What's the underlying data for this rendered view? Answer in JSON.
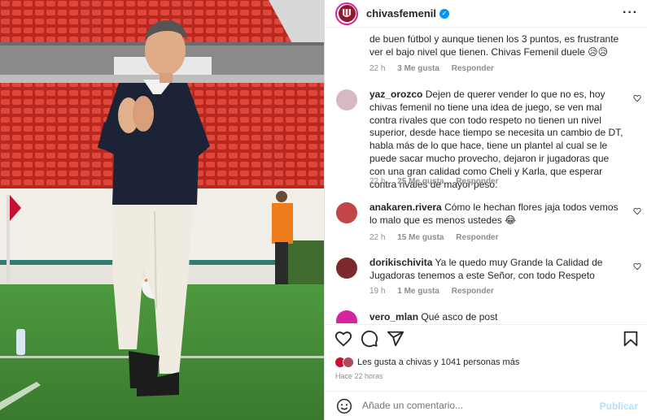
{
  "post": {
    "username": "chivasfemenil",
    "verified_mark": "✓",
    "more_icon": "more-horizontal-icon"
  },
  "comments": [
    {
      "username": "",
      "text": "de buen fútbol y aunque tienen los 3 puntos, es frustrante ver el bajo nivel que tienen. Chivas Femenil duele 😥😥",
      "time": "22 h",
      "likes": "3 Me gusta",
      "reply": "Responder"
    },
    {
      "username": "yaz_orozco",
      "text": "Dejen de querer vender lo que no es, hoy chivas femenil no tiene una idea de juego, se ven mal contra rivales que con todo respeto no tienen un nivel superior, desde hace tiempo se necesita un cambio de DT, habla más de lo que hace, tiene un plantel al cual se le puede sacar mucho provecho, dejaron ir jugadoras que con una gran calidad como Cheli y Karla, que esperar contra rivales de mayor peso.",
      "time": "22 h",
      "likes": "25 Me gusta",
      "reply": "Responder"
    },
    {
      "username": "anakaren.rivera",
      "text": "Cómo le hechan flores jaja todos vemos lo malo que es menos ustedes 😂",
      "time": "22 h",
      "likes": "15 Me gusta",
      "reply": "Responder"
    },
    {
      "username": "dorikischivita",
      "text": "Ya le quedo muy Grande la Calidad de Jugadoras tenemos a este Señor, con todo Respeto",
      "time": "19 h",
      "likes": "1 Me gusta",
      "reply": "Responder"
    },
    {
      "username": "vero_mlan",
      "text": "Qué asco de post",
      "time": "",
      "likes": "",
      "reply": ""
    }
  ],
  "actions": {
    "like_icon": "heart-icon",
    "comment_icon": "comment-icon",
    "share_icon": "share-icon",
    "save_icon": "bookmark-icon"
  },
  "likes": {
    "text": "Les gusta a chivas y 1041 personas más"
  },
  "time_ago": "Hace 22 horas",
  "add_comment": {
    "placeholder": "Añade un comentario...",
    "publish": "Publicar",
    "emoji_icon": "emoji-icon"
  },
  "colors": {
    "accent": "#0095f6",
    "publish_disabled": "#b2dffc",
    "muted": "#8e8e8e"
  }
}
